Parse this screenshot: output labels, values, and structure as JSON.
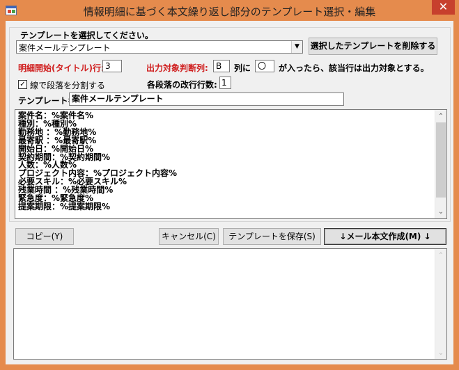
{
  "window": {
    "title": "情報明細に基づく本文繰り返し部分のテンプレート選択・編集",
    "close_glyph": "✕"
  },
  "template_group": {
    "legend": "テンプレートを選択してください。",
    "combo_value": "案件メールテンプレート",
    "delete_button": "選択したテンプレートを削除する"
  },
  "settings": {
    "start_row_label": "明細開始(タイトル)行:",
    "start_row_value": "3",
    "output_col_label": "出力対象判断列:",
    "output_col_value": "B",
    "col_suffix": "列に",
    "mark_value": "〇",
    "mark_suffix": "が入ったら、該当行は出力対象とする。",
    "split_checkbox_label": "線で段落を分割する",
    "split_checked": true,
    "line_feed_label": "各段落の改行行数:",
    "line_feed_value": "1",
    "template_name_label": "テンプレート名:",
    "template_name_value": "案件メールテンプレート"
  },
  "template_body": [
    "案件名：%案件名%",
    "種別：%種別%",
    "勤務地 ：%勤務地%",
    "最寄駅 ：%最寄駅%",
    "開始日：%開始日%",
    "契約期間：%契約期間%",
    "人数：%人数%",
    "プロジェクト内容：%プロジェクト内容%",
    "必要スキル：%必要スキル%",
    "残業時間 ：%残業時間%",
    "緊急度：%緊急度%",
    "提案期限：%提案期限%"
  ],
  "buttons": {
    "copy": "コピー(Y)",
    "cancel": "キャンセル(C)",
    "save_template": "テンプレートを保存(S)",
    "create_mail": "↓メール本文作成(M) ↓"
  },
  "output_text": "",
  "colors": {
    "titlebar": "#e58b4d",
    "close_button": "#c7402d",
    "red_label": "#d02020",
    "client_bg": "#f0f0f0"
  },
  "icons": {
    "app": "app-window-icon",
    "combo_arrow": "▼",
    "scroll_up": "⌃",
    "scroll_down": "⌄"
  }
}
